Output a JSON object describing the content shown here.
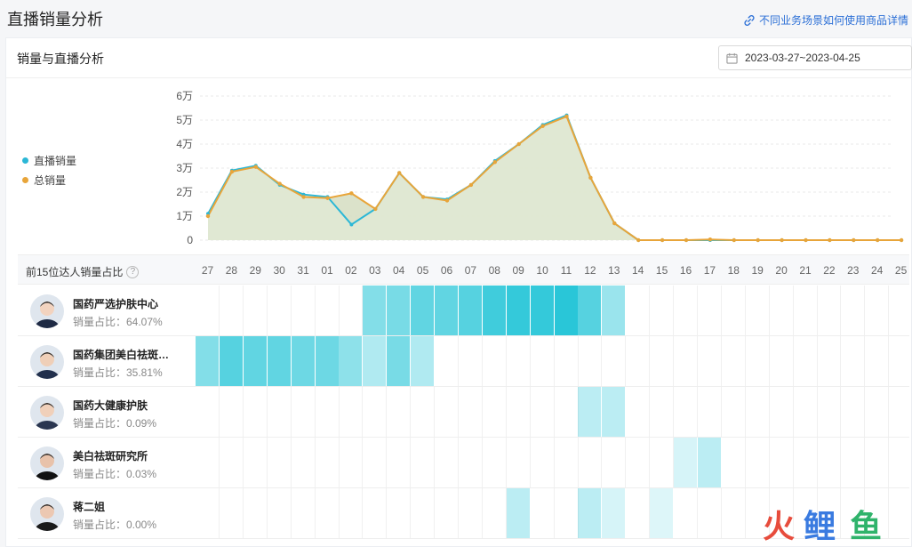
{
  "page": {
    "title": "直播销量分析",
    "help_link": "不同业务场景如何使用商品详情"
  },
  "card": {
    "title": "销量与直播分析",
    "date_range": "2023-03-27~2023-04-25"
  },
  "colors": {
    "live": "#2bb7d6",
    "total": "#e8a53a",
    "total_fill": "#d7dfc4",
    "heat": "#1ec3d6"
  },
  "chart_data": {
    "type": "line",
    "x": [
      "27",
      "28",
      "29",
      "30",
      "31",
      "01",
      "02",
      "03",
      "04",
      "05",
      "06",
      "07",
      "08",
      "09",
      "10",
      "11",
      "12",
      "13",
      "14",
      "15",
      "16",
      "17",
      "18",
      "19",
      "20",
      "21",
      "22",
      "23",
      "24",
      "25"
    ],
    "yticks": [
      "6万",
      "5万",
      "4万",
      "3万",
      "2万",
      "1万",
      "0"
    ],
    "ylim": [
      0,
      60000
    ],
    "series": [
      {
        "name": "直播销量",
        "values": [
          11000,
          29000,
          31000,
          23000,
          19000,
          18000,
          6500,
          13000,
          28000,
          18000,
          17000,
          23000,
          33000,
          40000,
          48000,
          52000,
          26000,
          7000,
          0,
          0,
          0,
          0,
          0,
          0,
          0,
          0,
          0,
          0,
          0,
          0
        ]
      },
      {
        "name": "总销量",
        "values": [
          10000,
          28500,
          30500,
          23500,
          18000,
          17500,
          19500,
          13000,
          28000,
          18000,
          16500,
          23000,
          32500,
          40000,
          47500,
          51500,
          26000,
          7000,
          0,
          0,
          0,
          300,
          0,
          0,
          0,
          0,
          0,
          0,
          0,
          0
        ]
      }
    ],
    "legend_position": "left",
    "grid": true
  },
  "contrib": {
    "header": "前15位达人销量占比",
    "share_prefix": "销量占比：",
    "kols": [
      {
        "name": "国药严选护肤中心",
        "share": "64.07%",
        "cells": [
          0,
          0,
          0,
          0,
          0,
          0,
          0,
          0.55,
          0.6,
          0.7,
          0.7,
          0.75,
          0.85,
          0.9,
          0.9,
          0.95,
          0.75,
          0.45,
          0,
          0,
          0,
          0,
          0,
          0,
          0,
          0,
          0,
          0,
          0,
          0
        ]
      },
      {
        "name": "国药集团美白祛斑…",
        "share": "35.81%",
        "cells": [
          0.55,
          0.75,
          0.7,
          0.7,
          0.65,
          0.65,
          0.5,
          0.35,
          0.6,
          0.35,
          0,
          0,
          0,
          0,
          0,
          0,
          0,
          0,
          0,
          0,
          0,
          0,
          0,
          0,
          0,
          0,
          0,
          0,
          0,
          0
        ]
      },
      {
        "name": "国药大健康护肤",
        "share": "0.09%",
        "cells": [
          0,
          0,
          0,
          0,
          0,
          0,
          0,
          0,
          0,
          0,
          0,
          0,
          0,
          0,
          0,
          0,
          0.3,
          0.3,
          0,
          0,
          0,
          0,
          0,
          0,
          0,
          0,
          0,
          0,
          0,
          0
        ]
      },
      {
        "name": "美白祛斑研究所",
        "share": "0.03%",
        "cells": [
          0,
          0,
          0,
          0,
          0,
          0,
          0,
          0,
          0,
          0,
          0,
          0,
          0,
          0,
          0,
          0,
          0,
          0,
          0,
          0,
          0.18,
          0.3,
          0,
          0,
          0,
          0,
          0,
          0,
          0,
          0
        ]
      },
      {
        "name": "蒋二姐",
        "share": "0.00%",
        "cells": [
          0,
          0,
          0,
          0,
          0,
          0,
          0,
          0,
          0,
          0,
          0,
          0,
          0,
          0.3,
          0,
          0,
          0.3,
          0.18,
          0,
          0.15,
          0,
          0,
          0,
          0,
          0,
          0,
          0,
          0,
          0,
          0
        ]
      }
    ]
  },
  "watermark": {
    "text": "火鲤鱼"
  }
}
